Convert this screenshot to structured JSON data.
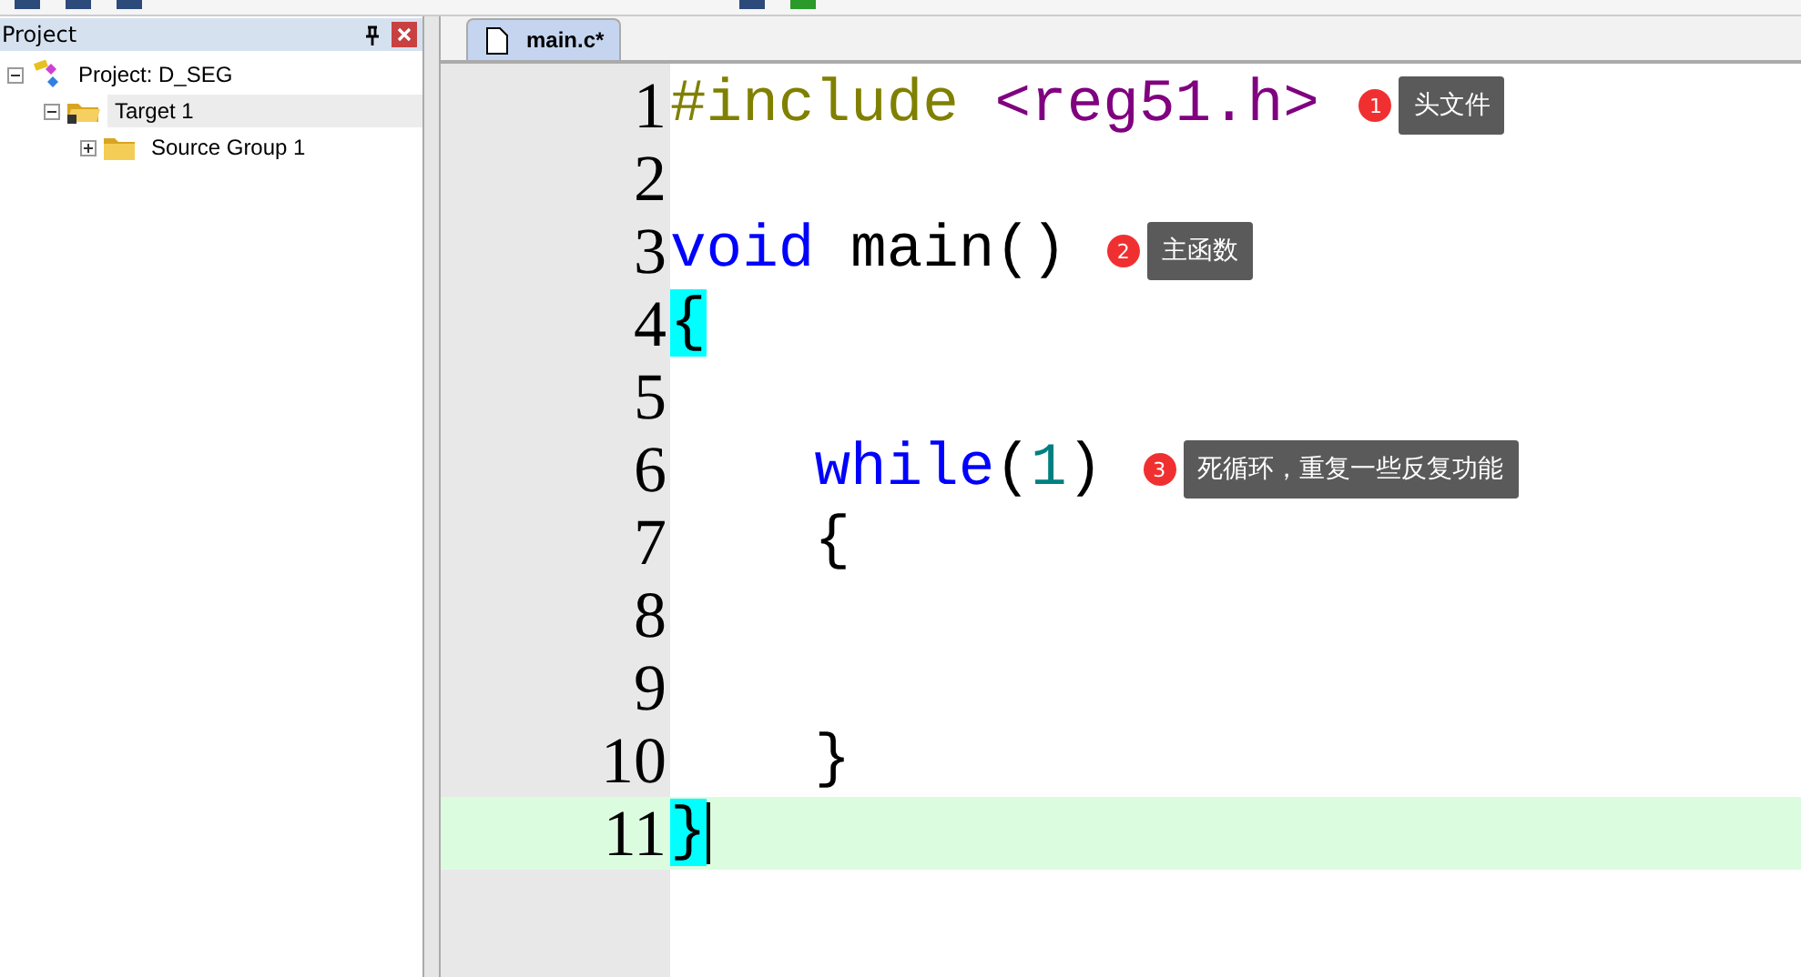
{
  "project_panel": {
    "title": "Project",
    "tree": [
      {
        "label": "Project: D_SEG",
        "kind": "project",
        "expanded": true,
        "selected": false,
        "children": [
          {
            "label": "Target 1",
            "kind": "target",
            "expanded": true,
            "selected": true,
            "children": [
              {
                "label": "Source Group 1",
                "kind": "group",
                "expanded": false,
                "selected": false
              }
            ]
          }
        ]
      }
    ]
  },
  "editor": {
    "tabs": [
      {
        "label": "main.c*",
        "selected": true
      }
    ],
    "lines": [
      {
        "number": "1",
        "current": false,
        "indented": false,
        "tokens": [
          {
            "text": "#include",
            "kind": "preprocessor"
          },
          {
            "text": " <reg51.h>",
            "kind": "header"
          }
        ],
        "annotation": {
          "badge": "1",
          "text": "头文件"
        }
      },
      {
        "number": "2",
        "current": false
      },
      {
        "number": "3",
        "current": false,
        "indented": false,
        "tokens": [
          {
            "text": "void",
            "kind": "keyword"
          },
          {
            "text": " main()",
            "kind": "plain"
          }
        ],
        "annotation": {
          "badge": "2",
          "text": "主函数"
        }
      },
      {
        "number": "4",
        "current": false,
        "indented": false,
        "tokens": [
          {
            "text": "{",
            "kind": "brace_match"
          }
        ]
      },
      {
        "number": "5",
        "current": false
      },
      {
        "number": "6",
        "current": false,
        "indented": true,
        "tokens": [
          {
            "text": "while",
            "kind": "keyword"
          },
          {
            "text": "(",
            "kind": "plain"
          },
          {
            "text": "1",
            "kind": "number"
          },
          {
            "text": ")",
            "kind": "plain"
          }
        ],
        "annotation": {
          "badge": "3",
          "text": "死循环，重复一些反复功能"
        }
      },
      {
        "number": "7",
        "current": false,
        "indented": true,
        "tokens": [
          {
            "text": "{",
            "kind": "plain"
          }
        ]
      },
      {
        "number": "8",
        "current": false
      },
      {
        "number": "9",
        "current": false
      },
      {
        "number": "10",
        "current": false,
        "indented": true,
        "tokens": [
          {
            "text": "}",
            "kind": "plain"
          }
        ]
      },
      {
        "number": "11",
        "current": true,
        "indented": false,
        "tokens": [
          {
            "text": "}",
            "kind": "brace_match"
          }
        ]
      }
    ]
  }
}
